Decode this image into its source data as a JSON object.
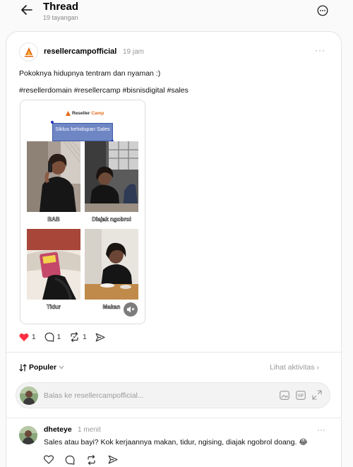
{
  "header": {
    "title": "Thread",
    "subtitle": "19 tayangan"
  },
  "post": {
    "username": "resellercampofficial",
    "time": "19 jam",
    "more": "···",
    "text": "Pokoknya hidupnya tentram dan nyaman :)",
    "hashtags": "#resellerdomain #resellercamp #bisnisdigital #sales",
    "media": {
      "brand_part1": "Reseller",
      "brand_part2": "Camp",
      "heading": "Siklus kehidupan Sales",
      "panels": [
        "BAB",
        "Diajak ngobrol",
        "Tidur",
        "Makan"
      ]
    },
    "likes": "1",
    "comments": "1",
    "reposts": "1"
  },
  "sort": {
    "label": "Populer",
    "activity_link": "Lihat aktivitas ›"
  },
  "reply": {
    "placeholder": "Balas ke resellercampofficial..."
  },
  "comment": {
    "username": "dheteye",
    "time": "1 menit",
    "more": "···",
    "text": "Sales atau bayi? Kok kerjaannya makan, tidur, ngising, diajak ngobrol doang. 😂"
  },
  "colors": {
    "like_red": "#ff3040",
    "brand_orange": "#e46a1a",
    "heading_blue": "#6f86c5"
  },
  "icons": [
    "back-arrow-icon",
    "more-circle-icon",
    "heart-icon",
    "comment-icon",
    "repost-icon",
    "share-icon",
    "sort-icon",
    "chevron-down-icon",
    "image-icon",
    "gif-icon",
    "expand-icon",
    "mute-icon"
  ]
}
